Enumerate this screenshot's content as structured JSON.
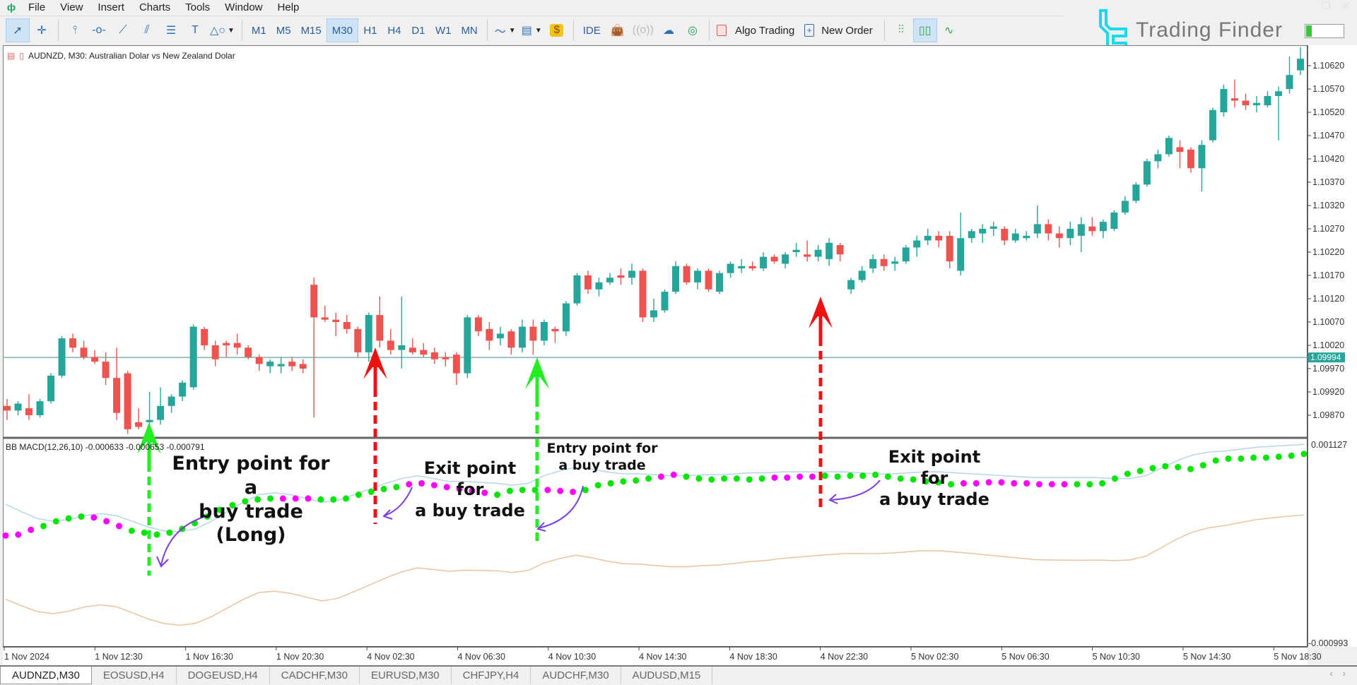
{
  "app": {
    "menu": [
      "File",
      "View",
      "Insert",
      "Charts",
      "Tools",
      "Window",
      "Help"
    ],
    "window_controls": [
      "restore-icon",
      "close-icon"
    ]
  },
  "toolbar": {
    "timeframes": [
      "M1",
      "M5",
      "M15",
      "M30",
      "H1",
      "H4",
      "D1",
      "W1",
      "MN"
    ],
    "active_timeframe": "M30",
    "ide_label": "IDE",
    "algo_trading_label": "Algo Trading",
    "new_order_label": "New Order",
    "brand": "Trading Finder"
  },
  "chart": {
    "title": "AUDNZD, M30:  Australian Dolar vs New Zealand Dolar",
    "current_price": "1.09994",
    "price_ticks": [
      "1.10620",
      "1.10570",
      "1.10520",
      "1.10470",
      "1.10420",
      "1.10370",
      "1.10320",
      "1.10270",
      "1.10220",
      "1.10170",
      "1.10120",
      "1.10070",
      "1.10020",
      "1.09970",
      "1.09920",
      "1.09870"
    ],
    "indicator_title": "BB MACD(12,26,10) -0.000633 -0.000653 -0.000791",
    "indicator_max": "0.001127",
    "indicator_min": "-0.000993",
    "time_ticks": [
      "1 Nov 2024",
      "1 Nov 12:30",
      "1 Nov 16:30",
      "1 Nov 20:30",
      "4 Nov 02:30",
      "4 Nov 06:30",
      "4 Nov 10:30",
      "4 Nov 14:30",
      "4 Nov 18:30",
      "4 Nov 22:30",
      "5 Nov 02:30",
      "5 Nov 06:30",
      "5 Nov 10:30",
      "5 Nov 14:30",
      "5 Nov 18:30"
    ],
    "colors": {
      "bull": "#26a69a",
      "bear": "#ef5350",
      "bb_upper": "#b5d6ea",
      "bb_lower": "#e8c4a0",
      "dot_up": "#00e600",
      "dot_down": "#ff00ff",
      "price_line": "#7fb3b0"
    }
  },
  "annotations": [
    {
      "text_lines": [
        "Entry point for a",
        "buy trade",
        "(Long)"
      ],
      "type": "entry"
    },
    {
      "text_lines": [
        "Exit point for",
        "a buy trade"
      ],
      "type": "exit"
    },
    {
      "text_lines": [
        "Entry point for",
        "a buy trade"
      ],
      "type": "entry"
    },
    {
      "text_lines": [
        "Exit point for",
        "a buy trade"
      ],
      "type": "exit"
    }
  ],
  "candles": [
    [
      1.0989,
      1.09905,
      1.0986,
      1.0988
    ],
    [
      1.0988,
      1.099,
      1.0987,
      1.09895
    ],
    [
      1.09885,
      1.09915,
      1.0986,
      1.0987
    ],
    [
      1.0987,
      1.09905,
      1.09865,
      1.099
    ],
    [
      1.099,
      1.0996,
      1.09895,
      1.09955
    ],
    [
      1.09955,
      1.1004,
      1.0995,
      1.10035
    ],
    [
      1.10035,
      1.10045,
      1.10005,
      1.10015
    ],
    [
      1.10015,
      1.1003,
      1.0999,
      1.09995
    ],
    [
      1.09995,
      1.1001,
      1.0998,
      1.09985
    ],
    [
      1.09985,
      1.10005,
      1.09935,
      1.0995
    ],
    [
      1.0995,
      1.10015,
      1.0986,
      1.09875
    ],
    [
      1.0996,
      1.09965,
      1.0983,
      1.0984
    ],
    [
      1.09855,
      1.09885,
      1.0984,
      1.09845
    ],
    [
      1.09855,
      1.0992,
      1.0985,
      1.0986
    ],
    [
      1.0986,
      1.0993,
      1.0985,
      1.0989
    ],
    [
      1.0989,
      1.09915,
      1.09875,
      1.0991
    ],
    [
      1.0991,
      1.09945,
      1.099,
      1.0994
    ],
    [
      1.0993,
      1.10065,
      1.09925,
      1.1006
    ],
    [
      1.10055,
      1.1006,
      1.1001,
      1.1002
    ],
    [
      1.1002,
      1.1003,
      1.09975,
      1.0999
    ],
    [
      1.10025,
      1.1003,
      1.09995,
      1.1002
    ],
    [
      1.10025,
      1.10045,
      1.1,
      1.10015
    ],
    [
      1.10015,
      1.1002,
      1.0999,
      1.09995
    ],
    [
      1.09995,
      1.1,
      1.09965,
      1.0998
    ],
    [
      1.09975,
      1.0999,
      1.0996,
      1.09985
    ],
    [
      1.09975,
      1.09995,
      1.0996,
      1.0998
    ],
    [
      1.09985,
      1.09995,
      1.09965,
      1.09975
    ],
    [
      1.0998,
      1.0999,
      1.0996,
      1.0997
    ],
    [
      1.1015,
      1.10165,
      1.09865,
      1.1008
    ],
    [
      1.1008,
      1.10105,
      1.1007,
      1.10075
    ],
    [
      1.10075,
      1.1009,
      1.1004,
      1.1007
    ],
    [
      1.1007,
      1.10085,
      1.10045,
      1.10055
    ],
    [
      1.10055,
      1.1006,
      1.09995,
      1.10005
    ],
    [
      1.10005,
      1.1009,
      1.09985,
      1.10085
    ],
    [
      1.10085,
      1.10125,
      1.10015,
      1.1003
    ],
    [
      1.1003,
      1.10055,
      1.1,
      1.1001
    ],
    [
      1.1001,
      1.10125,
      1.0997,
      1.1002
    ],
    [
      1.10015,
      1.10035,
      1.1,
      1.10005
    ],
    [
      1.1001,
      1.10025,
      1.09995,
      1.1
    ],
    [
      1.10005,
      1.10015,
      1.0998,
      1.0999
    ],
    [
      1.09995,
      1.10005,
      1.09975,
      1.0999
    ],
    [
      1.1,
      1.10005,
      1.09935,
      1.0996
    ],
    [
      1.0996,
      1.10085,
      1.0995,
      1.1008
    ],
    [
      1.1008,
      1.10085,
      1.1004,
      1.1005
    ],
    [
      1.10055,
      1.1007,
      1.1001,
      1.1003
    ],
    [
      1.10035,
      1.1006,
      1.1002,
      1.10045
    ],
    [
      1.1005,
      1.10055,
      1.1,
      1.10015
    ],
    [
      1.10015,
      1.10075,
      1.10005,
      1.1006
    ],
    [
      1.1006,
      1.10075,
      1.1,
      1.1003
    ],
    [
      1.1003,
      1.10075,
      1.1002,
      1.1007
    ],
    [
      1.10055,
      1.1006,
      1.10025,
      1.1005
    ],
    [
      1.1005,
      1.10115,
      1.1004,
      1.1011
    ],
    [
      1.1011,
      1.10175,
      1.10105,
      1.1017
    ],
    [
      1.1017,
      1.1018,
      1.1013,
      1.1014
    ],
    [
      1.1014,
      1.10165,
      1.10125,
      1.10155
    ],
    [
      1.10155,
      1.10175,
      1.1015,
      1.10165
    ],
    [
      1.1017,
      1.10185,
      1.1015,
      1.10165
    ],
    [
      1.10165,
      1.10195,
      1.1015,
      1.1018
    ],
    [
      1.1018,
      1.10185,
      1.1007,
      1.1008
    ],
    [
      1.1008,
      1.1012,
      1.1007,
      1.10095
    ],
    [
      1.10095,
      1.1014,
      1.1009,
      1.10135
    ],
    [
      1.10135,
      1.102,
      1.1013,
      1.1019
    ],
    [
      1.1019,
      1.10195,
      1.1015,
      1.10155
    ],
    [
      1.10155,
      1.10185,
      1.1014,
      1.1018
    ],
    [
      1.1018,
      1.10185,
      1.10135,
      1.1014
    ],
    [
      1.10135,
      1.1018,
      1.1013,
      1.10175
    ],
    [
      1.10175,
      1.102,
      1.10165,
      1.10195
    ],
    [
      1.10185,
      1.10205,
      1.10175,
      1.1019
    ],
    [
      1.1019,
      1.102,
      1.1018,
      1.10185
    ],
    [
      1.10185,
      1.1022,
      1.1018,
      1.1021
    ],
    [
      1.1021,
      1.10215,
      1.10195,
      1.102
    ],
    [
      1.10195,
      1.1022,
      1.10185,
      1.10215
    ],
    [
      1.1022,
      1.1024,
      1.1021,
      1.10225
    ],
    [
      1.10215,
      1.10245,
      1.102,
      1.1021
    ],
    [
      1.1021,
      1.10235,
      1.102,
      1.10225
    ],
    [
      1.10205,
      1.1025,
      1.1019,
      1.1024
    ],
    [
      1.10235,
      1.1024,
      1.102,
      1.10215
    ],
    [
      1.1014,
      1.10165,
      1.1013,
      1.1016
    ],
    [
      1.1016,
      1.1019,
      1.10155,
      1.1018
    ],
    [
      1.10185,
      1.10215,
      1.10175,
      1.10205
    ],
    [
      1.10205,
      1.10215,
      1.1018,
      1.1019
    ],
    [
      1.10195,
      1.1021,
      1.1018,
      1.102
    ],
    [
      1.102,
      1.10235,
      1.10195,
      1.1023
    ],
    [
      1.1023,
      1.10255,
      1.1021,
      1.10245
    ],
    [
      1.10245,
      1.1027,
      1.10235,
      1.10255
    ],
    [
      1.10255,
      1.10265,
      1.1023,
      1.10245
    ],
    [
      1.10255,
      1.10265,
      1.10185,
      1.102
    ],
    [
      1.1018,
      1.10305,
      1.1017,
      1.1025
    ],
    [
      1.1025,
      1.1027,
      1.1024,
      1.10265
    ],
    [
      1.1026,
      1.1028,
      1.1024,
      1.1027
    ],
    [
      1.1027,
      1.10285,
      1.10255,
      1.10275
    ],
    [
      1.1027,
      1.10275,
      1.10235,
      1.10245
    ],
    [
      1.10245,
      1.1027,
      1.1024,
      1.1026
    ],
    [
      1.1025,
      1.10265,
      1.10245,
      1.10255
    ],
    [
      1.1026,
      1.1032,
      1.1025,
      1.1028
    ],
    [
      1.1028,
      1.1029,
      1.10245,
      1.1026
    ],
    [
      1.1026,
      1.10275,
      1.1023,
      1.1025
    ],
    [
      1.1025,
      1.10285,
      1.10235,
      1.1027
    ],
    [
      1.10255,
      1.10295,
      1.1022,
      1.1028
    ],
    [
      1.10275,
      1.10295,
      1.10255,
      1.10265
    ],
    [
      1.10265,
      1.1029,
      1.1025,
      1.10285
    ],
    [
      1.1027,
      1.1031,
      1.10265,
      1.10305
    ],
    [
      1.10305,
      1.1034,
      1.103,
      1.1033
    ],
    [
      1.1033,
      1.1037,
      1.10325,
      1.10365
    ],
    [
      1.10365,
      1.1042,
      1.1036,
      1.10415
    ],
    [
      1.10415,
      1.1044,
      1.104,
      1.1043
    ],
    [
      1.1043,
      1.1047,
      1.10425,
      1.10465
    ],
    [
      1.10445,
      1.1046,
      1.104,
      1.10435
    ],
    [
      1.1044,
      1.10445,
      1.1039,
      1.104
    ],
    [
      1.104,
      1.1046,
      1.1035,
      1.1045
    ],
    [
      1.1046,
      1.1053,
      1.10455,
      1.10525
    ],
    [
      1.1052,
      1.1058,
      1.1051,
      1.1057
    ],
    [
      1.1055,
      1.1059,
      1.1053,
      1.10545
    ],
    [
      1.10545,
      1.1056,
      1.10525,
      1.10535
    ],
    [
      1.10535,
      1.10555,
      1.1052,
      1.1054
    ],
    [
      1.10535,
      1.10565,
      1.1053,
      1.10555
    ],
    [
      1.10555,
      1.10575,
      1.1046,
      1.10565
    ],
    [
      1.1057,
      1.1064,
      1.1056,
      1.106
    ],
    [
      1.1061,
      1.1066,
      1.106,
      1.10635
    ]
  ],
  "macd": {
    "dots": [
      0.00015,
      0.00016,
      0.00021,
      0.00025,
      0.0003,
      0.00033,
      0.00035,
      0.00034,
      0.0003,
      0.00025,
      0.0002,
      0.00018,
      0.00016,
      0.00018,
      0.00022,
      0.00028,
      0.00035,
      0.00042,
      0.00047,
      0.00051,
      0.00053,
      0.00054,
      0.00054,
      0.00054,
      0.00054,
      0.00053,
      0.00053,
      0.00054,
      0.00058,
      0.00061,
      0.00064,
      0.00066,
      0.00069,
      0.0007,
      0.00068,
      0.00066,
      0.00064,
      0.00062,
      0.0006,
      0.00058,
      0.00062,
      0.00063,
      0.00063,
      0.00063,
      0.00062,
      0.00061,
      0.00063,
      0.00068,
      0.0007,
      0.00072,
      0.00073,
      0.00075,
      0.00077,
      0.00079,
      0.00077,
      0.00075,
      0.00074,
      0.00075,
      0.00075,
      0.00074,
      0.00075,
      0.00076,
      0.00076,
      0.00077,
      0.00077,
      0.00078,
      0.00077,
      0.00078,
      0.00078,
      0.00079,
      0.00077,
      0.00075,
      0.00074,
      0.00072,
      0.00071,
      0.00069,
      0.0007,
      0.0007,
      0.00071,
      0.00071,
      0.0007,
      0.0007,
      0.00069,
      0.00069,
      0.00069,
      0.00069,
      0.00069,
      0.0007,
      0.00075,
      0.0008,
      0.00083,
      0.00086,
      0.00088,
      0.00087,
      0.00085,
      0.00089,
      0.00094,
      0.00096,
      0.00096,
      0.00097,
      0.00097,
      0.00098,
      0.00099,
      0.00101
    ],
    "dot_colors": "ddduuuuddduuuuuuuuuuuuddduuuuuuuddddddduuuuddduuuuuudduuuuuuudddduuuuuuuuuuuddddddddduuuuuuuuuuuuuuuuuuuuuu",
    "upper": [
      0.00048,
      0.0004,
      0.00033,
      0.0003,
      0.00032,
      0.00036,
      0.00038,
      0.00036,
      0.0003,
      0.00024,
      0.0002,
      0.00019,
      0.00022,
      0.0003,
      0.0004,
      0.0005,
      0.00058,
      0.0006,
      0.00058,
      0.00054,
      0.0005,
      0.00052,
      0.00058,
      0.00064,
      0.0007,
      0.00075,
      0.00078,
      0.00075,
      0.00072,
      0.00072,
      0.00071,
      0.0007,
      0.00068,
      0.0007,
      0.00078,
      0.00083,
      0.00087,
      0.00085,
      0.00082,
      0.0008,
      0.0008,
      0.00079,
      0.00078,
      0.00078,
      0.00079,
      0.00079,
      0.0008,
      0.00081,
      0.00081,
      0.00082,
      0.00082,
      0.00082,
      0.00082,
      0.00082,
      0.00081,
      0.0008,
      0.0008,
      0.00081,
      0.00082,
      0.00082,
      0.00081,
      0.0008,
      0.00079,
      0.00078,
      0.00077,
      0.00076,
      0.00076,
      0.00076,
      0.00076,
      0.00076,
      0.00075,
      0.00075,
      0.00078,
      0.00086,
      0.00094,
      0.001,
      0.00103,
      0.00104,
      0.00106,
      0.00108,
      0.00109,
      0.0011,
      0.00111
    ]
  }
}
